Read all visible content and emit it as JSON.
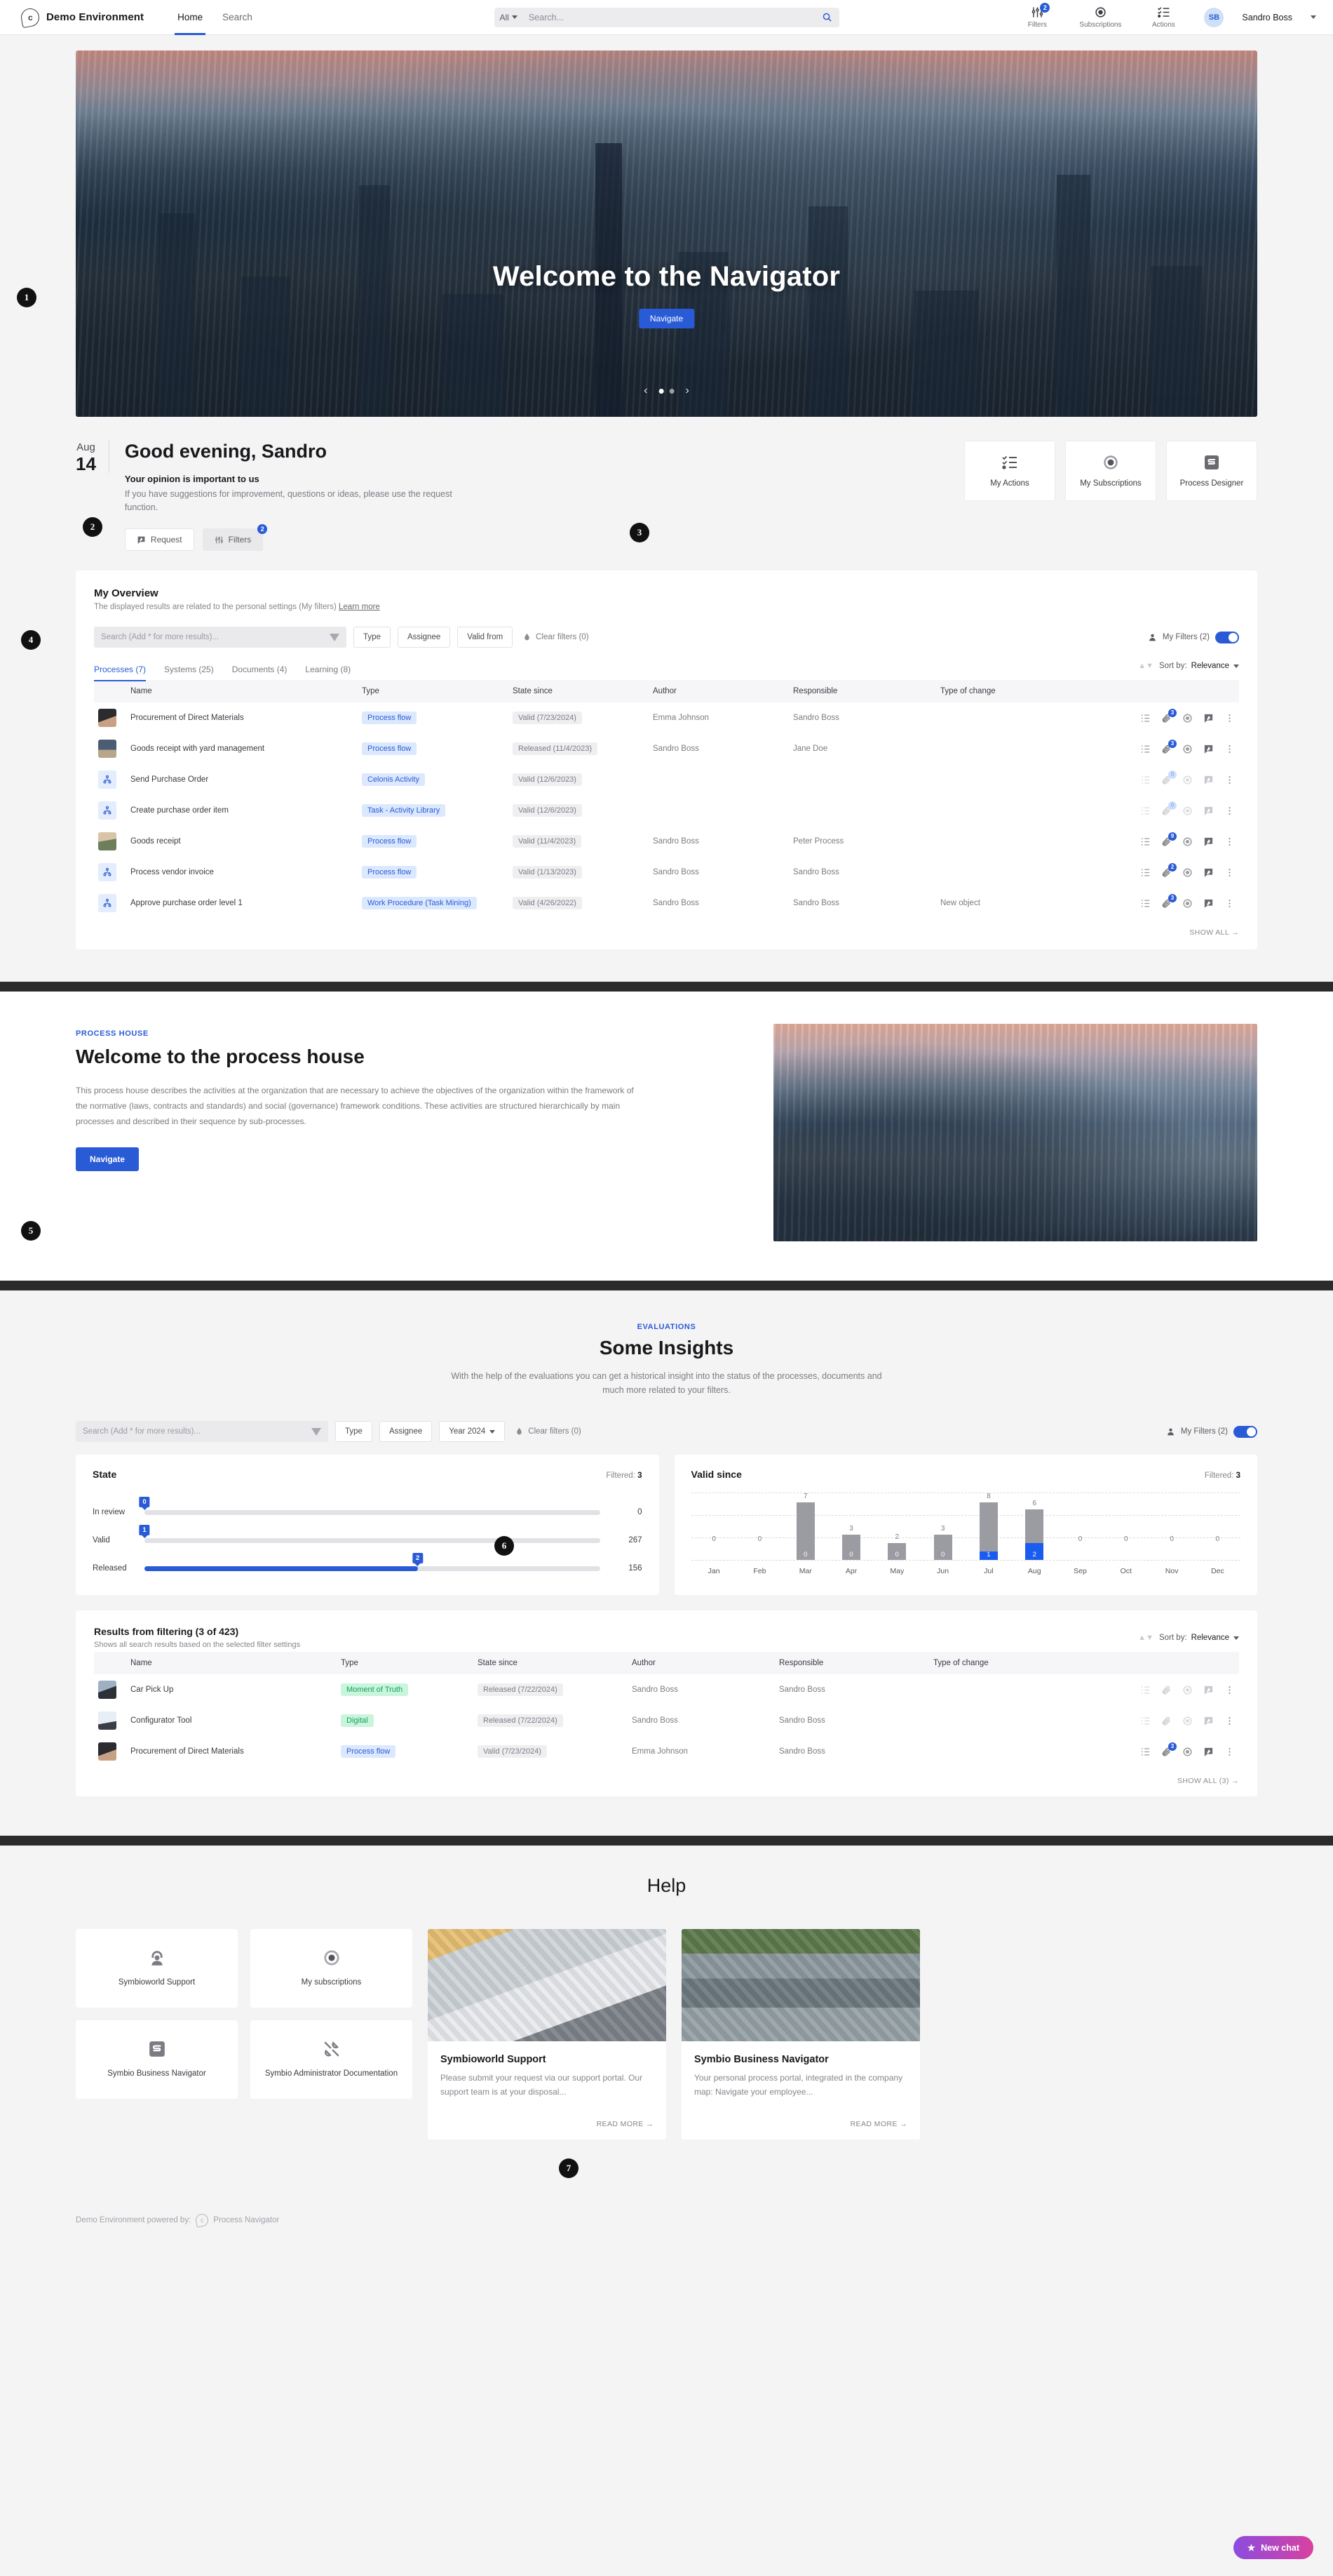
{
  "header": {
    "brand": "Demo Environment",
    "logo_icon": "drop-c-logo-icon",
    "nav": [
      {
        "label": "Home",
        "active": true
      },
      {
        "label": "Search",
        "active": false
      }
    ],
    "search": {
      "scope": "All",
      "placeholder": "Search...",
      "value": "",
      "icon": "search-icon"
    },
    "actions": [
      {
        "label": "Filters",
        "icon": "sliders-icon",
        "badge": "2"
      },
      {
        "label": "Subscriptions",
        "icon": "eye-icon",
        "badge": ""
      },
      {
        "label": "Actions",
        "icon": "checklist-icon",
        "badge": ""
      }
    ],
    "user": {
      "initials": "SB",
      "name": "Sandro Boss",
      "caret": "chevron-down-icon"
    }
  },
  "steps": {
    "s1": "1",
    "s2": "2",
    "s3": "3",
    "s4": "4",
    "s5": "5",
    "s6": "6",
    "s7": "7"
  },
  "hero": {
    "title": "Welcome to the Navigator",
    "button": "Navigate",
    "prev_icon": "chevron-left-icon",
    "next_icon": "chevron-right-icon",
    "dots": 2,
    "active_dot": 0
  },
  "greeting": {
    "month": "Aug",
    "day": "14",
    "title": "Good evening, Sandro",
    "subtitle": "Your opinion is important to us",
    "text": "If you have suggestions for improvement, questions or ideas, please use the request function.",
    "request_button": "Request",
    "filters_button": "Filters",
    "filters_badge": "2"
  },
  "quick_cards": [
    {
      "label": "My Actions",
      "icon": "checklist-icon"
    },
    {
      "label": "My Subscriptions",
      "icon": "eye-icon"
    },
    {
      "label": "Process Designer",
      "icon": "symbio-s-icon"
    }
  ],
  "overview": {
    "title": "My Overview",
    "subtitle": "The displayed results are related to the personal settings (My filters)",
    "learn_more": "Learn more",
    "search_placeholder": "Search (Add * for more results)...",
    "search_value": "",
    "filter_buttons": [
      "Type",
      "Assignee",
      "Valid from"
    ],
    "clear_filters": "Clear filters (0)",
    "my_filters": "My Filters (2)",
    "my_filters_on": true,
    "sort_label": "Sort by:",
    "sort_value": "Relevance",
    "tabs": [
      {
        "label": "Processes (7)",
        "active": true
      },
      {
        "label": "Systems (25)",
        "active": false
      },
      {
        "label": "Documents (4)",
        "active": false
      },
      {
        "label": "Learning (8)",
        "active": false
      }
    ],
    "columns": [
      "Name",
      "Type",
      "State since",
      "Author",
      "Responsible",
      "Type of change"
    ],
    "rows": [
      {
        "thumb": "th-buy",
        "icon": "",
        "name": "Procurement of Direct Materials",
        "type": "Process flow",
        "type_style": "chip-blue",
        "state": "Valid (7/23/2024)",
        "author": "Emma Johnson",
        "responsible": "Sandro Boss",
        "change": "",
        "attach": "3",
        "dim": false
      },
      {
        "thumb": "th-yard",
        "icon": "",
        "name": "Goods receipt with yard management",
        "type": "Process flow",
        "type_style": "chip-blue",
        "state": "Released (11/4/2023)",
        "author": "Sandro Boss",
        "responsible": "Jane Doe",
        "change": "",
        "attach": "3",
        "dim": false
      },
      {
        "thumb": "",
        "icon": "org-chart-icon",
        "name": "Send Purchase Order",
        "type": "Celonis Activity",
        "type_style": "chip-blue",
        "state": "Valid (12/6/2023)",
        "author": "",
        "responsible": "",
        "change": "",
        "attach": "0",
        "dim": true
      },
      {
        "thumb": "",
        "icon": "org-chart-icon",
        "name": "Create purchase order item",
        "type": "Task - Activity Library",
        "type_style": "chip-blue",
        "state": "Valid (12/6/2023)",
        "author": "",
        "responsible": "",
        "change": "",
        "attach": "0",
        "dim": true
      },
      {
        "thumb": "th-goods",
        "icon": "",
        "name": "Goods receipt",
        "type": "Process flow",
        "type_style": "chip-blue",
        "state": "Valid (11/4/2023)",
        "author": "Sandro Boss",
        "responsible": "Peter Process",
        "change": "",
        "attach": "9",
        "dim": false
      },
      {
        "thumb": "",
        "icon": "org-chart-icon",
        "name": "Process vendor invoice",
        "type": "Process flow",
        "type_style": "chip-blue",
        "state": "Valid (1/13/2023)",
        "author": "Sandro Boss",
        "responsible": "Sandro Boss",
        "change": "",
        "attach": "2",
        "dim": false
      },
      {
        "thumb": "",
        "icon": "org-chart-icon",
        "name": "Approve purchase order level 1",
        "type": "Work Procedure (Task Mining)",
        "type_style": "chip-blue",
        "state": "Valid (4/26/2022)",
        "author": "Sandro Boss",
        "responsible": "Sandro Boss",
        "change": "New object",
        "attach": "3",
        "dim": false
      }
    ],
    "show_all": "SHOW ALL →"
  },
  "process_house": {
    "kicker": "PROCESS HOUSE",
    "title": "Welcome to the process house",
    "body": "This process house describes the activities at the organization that are necessary to achieve the objectives of the organization within the framework of the normative (laws, contracts and standards) and social (governance) framework conditions. These activities are structured hierarchically by main processes and described in their sequence by sub-processes.",
    "button": "Navigate"
  },
  "insights": {
    "kicker": "EVALUATIONS",
    "title": "Some Insights",
    "subtitle": "With the help of the evaluations you can get a historical insight into the status of the processes, documents and much more related to your filters.",
    "search_placeholder": "Search (Add * for more results)...",
    "search_value": "",
    "filter_buttons": [
      "Type",
      "Assignee"
    ],
    "year_filter": "Year 2024",
    "clear_filters": "Clear filters (0)",
    "my_filters": "My Filters (2)",
    "my_filters_on": true
  },
  "chart_data": [
    {
      "type": "bar",
      "orientation": "horizontal",
      "title": "State",
      "filtered_label": "Filtered:",
      "filtered_value": "3",
      "categories": [
        "In review",
        "Valid",
        "Released"
      ],
      "values": [
        0,
        267,
        156
      ],
      "markers": [
        0,
        1,
        2
      ],
      "marker_positions_pct": [
        0,
        0,
        0.6
      ],
      "xlabel": "",
      "ylabel": "",
      "grid": false
    },
    {
      "type": "bar",
      "orientation": "vertical",
      "title": "Valid since",
      "filtered_label": "Filtered:",
      "filtered_value": "3",
      "categories": [
        "Jan",
        "Feb",
        "Mar",
        "Apr",
        "May",
        "Jun",
        "Jul",
        "Aug",
        "Sep",
        "Oct",
        "Nov",
        "Dec"
      ],
      "series": [
        {
          "name": "Total",
          "values": [
            0,
            0,
            7,
            3,
            2,
            3,
            8,
            6,
            0,
            0,
            0,
            0
          ]
        },
        {
          "name": "Filtered",
          "values": [
            0,
            0,
            0,
            0,
            0,
            0,
            1,
            2,
            0,
            0,
            0,
            0
          ]
        }
      ],
      "ylim": [
        0,
        8
      ],
      "grid": true,
      "gridlines": 4,
      "highlight_months": [
        "Jul",
        "Aug"
      ]
    }
  ],
  "results": {
    "title": "Results from filtering (3 of 423)",
    "subtitle": "Shows all search results based on the selected filter settings",
    "sort_label": "Sort by:",
    "sort_value": "Relevance",
    "columns": [
      "Name",
      "Type",
      "State since",
      "Author",
      "Responsible",
      "Type of change"
    ],
    "rows": [
      {
        "thumb": "th-car",
        "name": "Car Pick Up",
        "type": "Moment of Truth",
        "type_style": "chip-green",
        "state": "Released (7/22/2024)",
        "author": "Sandro Boss",
        "responsible": "Sandro Boss",
        "change": "",
        "attach": "",
        "dim": true
      },
      {
        "thumb": "th-conf",
        "name": "Configurator Tool",
        "type": "Digital",
        "type_style": "chip-green",
        "state": "Released (7/22/2024)",
        "author": "Sandro Boss",
        "responsible": "Sandro Boss",
        "change": "",
        "attach": "",
        "dim": true
      },
      {
        "thumb": "th-buy",
        "name": "Procurement of Direct Materials",
        "type": "Process flow",
        "type_style": "chip-blue",
        "state": "Valid (7/23/2024)",
        "author": "Emma Johnson",
        "responsible": "Sandro Boss",
        "change": "",
        "attach": "3",
        "dim": false
      }
    ],
    "show_all": "SHOW ALL (3) →"
  },
  "help": {
    "title": "Help",
    "tiles": [
      {
        "label": "Symbioworld Support",
        "icon": "headset-support-icon"
      },
      {
        "label": "My subscriptions",
        "icon": "eye-icon"
      },
      {
        "label": "Symbio Business Navigator",
        "icon": "symbio-s-icon"
      },
      {
        "label": "Symbio Administrator Documentation",
        "icon": "tools-icon"
      }
    ],
    "cards": [
      {
        "image": "nc-desk",
        "title": "Symbioworld Support",
        "text": "Please submit your request via our support portal. Our support team is at your disposal...",
        "link": "READ MORE →"
      },
      {
        "image": "nc-road",
        "title": "Symbio Business Navigator",
        "text": "Your personal process portal, integrated in the company map: Navigate your employee...",
        "link": "READ MORE →"
      }
    ]
  },
  "footer": {
    "text": "Demo Environment powered by:",
    "product": "Process Navigator",
    "logo_icon": "drop-c-logo-icon"
  },
  "chat": {
    "label": "New chat",
    "icon": "star-icon"
  },
  "colors": {
    "accent": "#2a5bd7",
    "chip_blue_bg": "#dbe8fd",
    "chip_green_bg": "#c8f5dc",
    "bar_grey": "#9b9ba2",
    "bar_blue": "#1a5cf0"
  }
}
